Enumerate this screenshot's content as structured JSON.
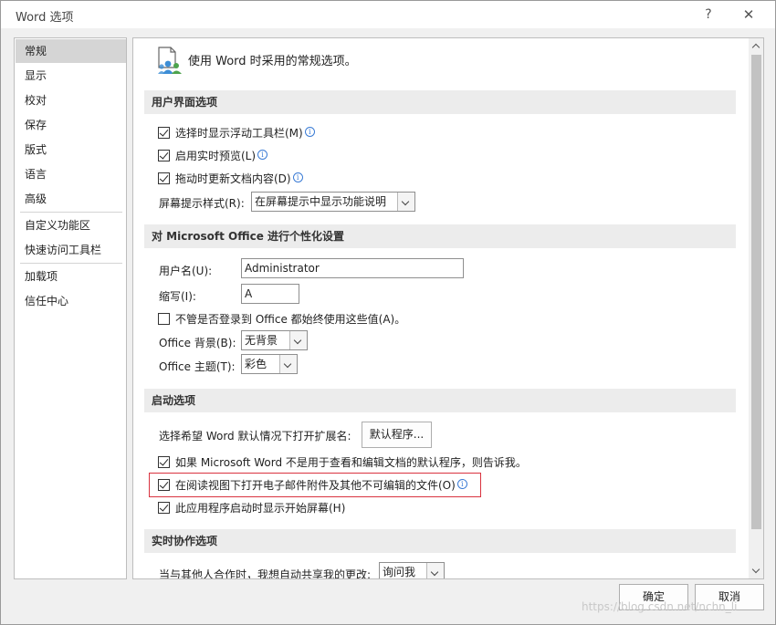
{
  "window": {
    "title": "Word 选项",
    "help_label": "?",
    "close_label": "✕"
  },
  "sidebar": {
    "items": [
      {
        "label": "常规"
      },
      {
        "label": "显示"
      },
      {
        "label": "校对"
      },
      {
        "label": "保存"
      },
      {
        "label": "版式"
      },
      {
        "label": "语言"
      },
      {
        "label": "高级"
      },
      {
        "label": "自定义功能区"
      },
      {
        "label": "快速访问工具栏"
      },
      {
        "label": "加载项"
      },
      {
        "label": "信任中心"
      }
    ]
  },
  "header": {
    "icon": "general-options-icon",
    "text": "使用 Word 时采用的常规选项。"
  },
  "ui_section": {
    "title": "用户界面选项",
    "options": [
      {
        "label": "选择时显示浮动工具栏(M)",
        "checked": true,
        "info": true
      },
      {
        "label": "启用实时预览(L)",
        "checked": true,
        "info": true
      },
      {
        "label": "拖动时更新文档内容(D)",
        "checked": true,
        "info": true
      }
    ],
    "screentip_label": "屏幕提示样式(R):",
    "screentip_value": "在屏幕提示中显示功能说明"
  },
  "personalize_section": {
    "title": "对 Microsoft Office 进行个性化设置",
    "username_label": "用户名(U):",
    "username_value": "Administrator",
    "initials_label": "缩写(I):",
    "initials_value": "A",
    "always_use_label": "不管是否登录到 Office 都始终使用这些值(A)。",
    "always_use_checked": false,
    "background_label": "Office 背景(B):",
    "background_value": "无背景",
    "theme_label": "Office 主题(T):",
    "theme_value": "彩色"
  },
  "startup_section": {
    "title": "启动选项",
    "extensions_label": "选择希望 Word 默认情况下打开扩展名:",
    "default_programs_button": "默认程序...",
    "options": [
      {
        "label": "如果 Microsoft Word 不是用于查看和编辑文档的默认程序，则告诉我。",
        "checked": true,
        "info": false
      },
      {
        "label": "在阅读视图下打开电子邮件附件及其他不可编辑的文件(O)",
        "checked": true,
        "info": true
      },
      {
        "label": "此应用程序启动时显示开始屏幕(H)",
        "checked": true,
        "info": false
      }
    ]
  },
  "coauthor_section": {
    "title": "实时协作选项",
    "share_label": "当与其他人合作时，我想自动共享我的更改:",
    "share_value": "询问我"
  },
  "footer": {
    "ok_label": "确定",
    "cancel_label": "取消"
  },
  "watermark": "https://blog.csdn.net/nchn_li",
  "colors": {
    "highlight_border": "#d9333f",
    "info_icon": "#3a7bd5",
    "selected_nav": "#d5d5d5"
  }
}
